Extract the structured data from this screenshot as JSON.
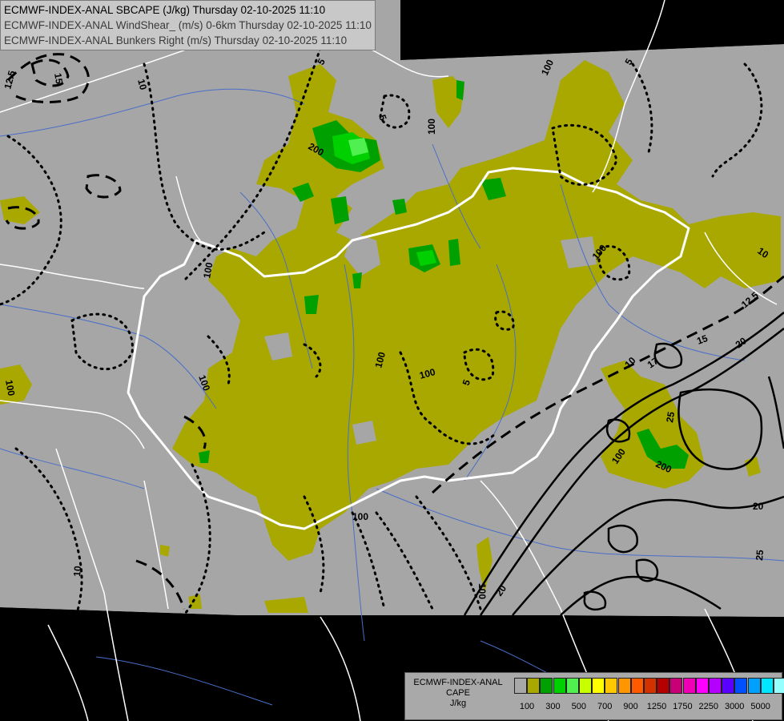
{
  "titles": {
    "line1": "ECMWF-INDEX-ANAL SBCAPE (J/kg) Thursday 02-10-2025 11:10",
    "line2": "ECMWF-INDEX-ANAL WindShear_ (m/s) 0-6km Thursday 02-10-2025 11:10",
    "line3": "ECMWF-INDEX-ANAL Bunkers Right (m/s) Thursday 02-10-2025 11:10"
  },
  "legend": {
    "name_line1": "ECMWF-INDEX-ANAL",
    "name_line2": "CAPE",
    "name_line3": "J/kg",
    "colors": [
      "#a8a8a8",
      "#a8a800",
      "#00a000",
      "#00d000",
      "#50f050",
      "#c8ff00",
      "#ffff00",
      "#ffc800",
      "#ff9600",
      "#ff5a00",
      "#d23200",
      "#b40000",
      "#c80078",
      "#f000b4",
      "#ff00ff",
      "#b400ff",
      "#5a00ff",
      "#0050ff",
      "#00a0ff",
      "#00e6ff",
      "#96ffff",
      "#ffffff"
    ],
    "ticks": [
      "100",
      "300",
      "500",
      "700",
      "900",
      "1250",
      "1750",
      "2250",
      "3000",
      "5000"
    ]
  },
  "contour_labels": {
    "shear_12_5": "12.5",
    "shear_15": "15",
    "shear_10": "10",
    "shear_20": "20",
    "shear_25": "25",
    "bunkers_5": "5",
    "bunkers_10": "10",
    "bunkers_15": "15",
    "bunkers_17": "17",
    "cape_100": "100",
    "cape_200": "200"
  },
  "colors": {
    "background_nodata": "#000000",
    "domain_gray": "#a6a6a6",
    "cape_100": "#a8a800",
    "cape_300": "#00a000",
    "cape_500": "#00d000",
    "cape_700": "#50f050",
    "border": "#ffffff",
    "rivers": "#4a6ec8"
  }
}
